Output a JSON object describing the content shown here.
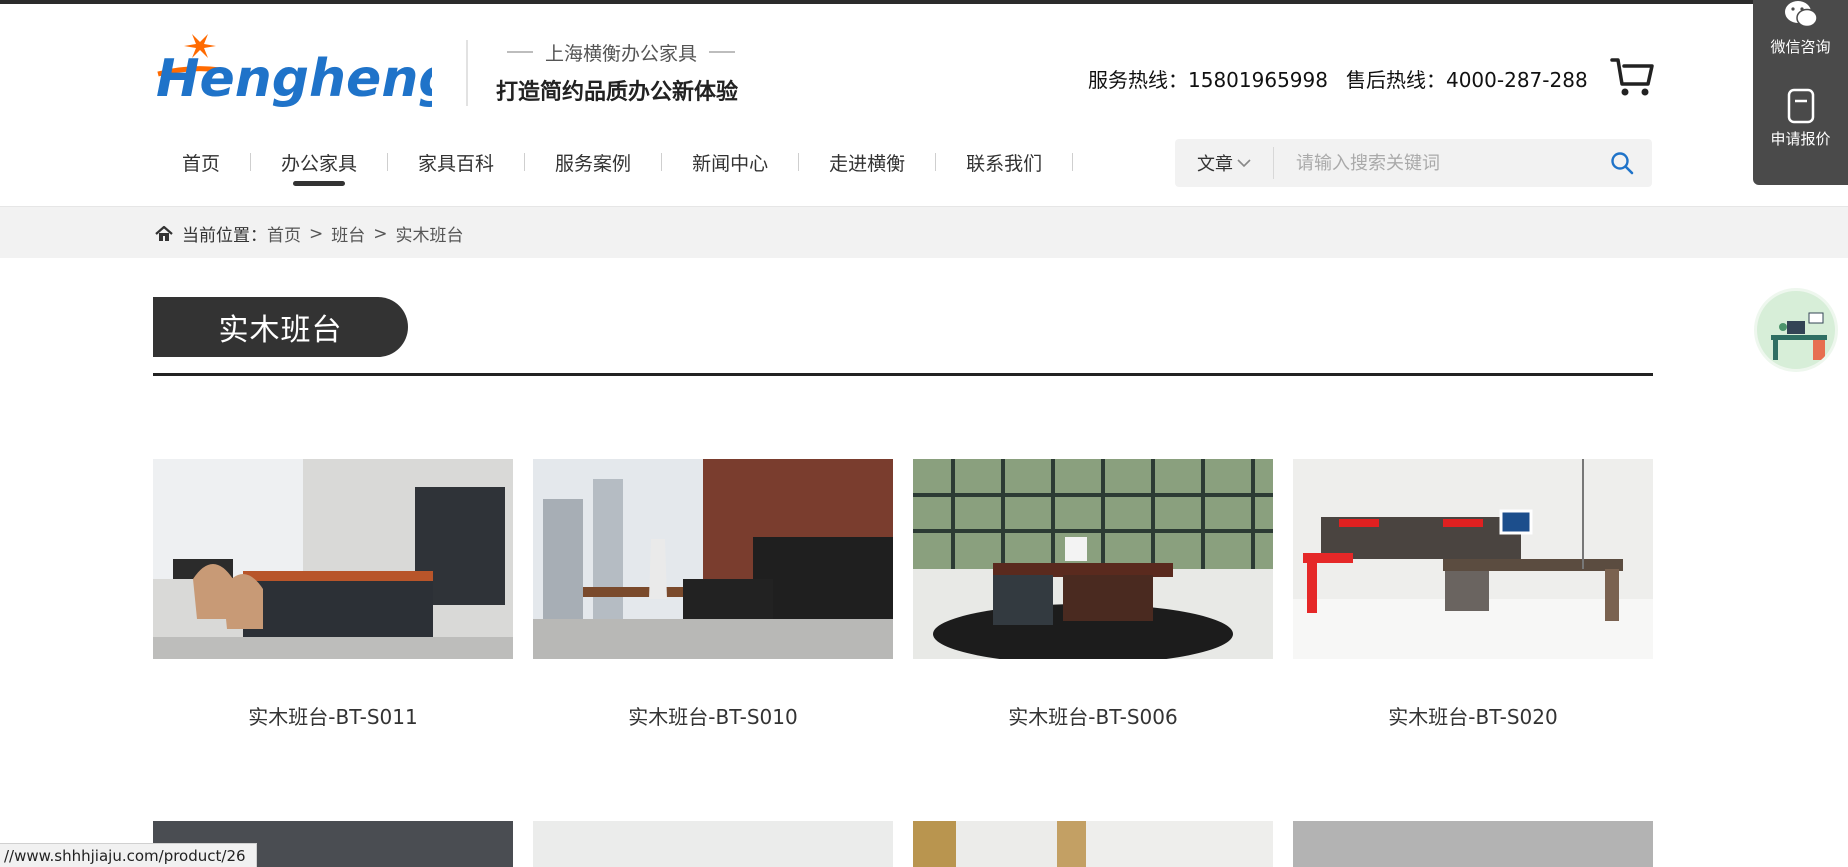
{
  "brand": {
    "logo_text": "Hengheng",
    "slogan_top": "上海横衡办公家具",
    "slogan_main": "打造简约品质办公新体验"
  },
  "hotline": {
    "service": "服务热线：15801965998",
    "aftersale": "售后热线：4000-287-288"
  },
  "nav": {
    "items": [
      {
        "label": "首页"
      },
      {
        "label": "办公家具"
      },
      {
        "label": "家具百科"
      },
      {
        "label": "服务案例"
      },
      {
        "label": "新闻中心"
      },
      {
        "label": "走进横衡"
      },
      {
        "label": "联系我们"
      }
    ],
    "active_index": 1
  },
  "search": {
    "type_label": "文章",
    "placeholder": "请输入搜索关键词"
  },
  "breadcrumb": {
    "prefix": "当前位置：",
    "items": [
      "首页",
      "班台",
      "实木班台"
    ],
    "separator": ">"
  },
  "category": {
    "title": "实木班台"
  },
  "products": [
    {
      "name": "实木班台-BT-S011"
    },
    {
      "name": "实木班台-BT-S010"
    },
    {
      "name": "实木班台-BT-S006"
    },
    {
      "name": "实木班台-BT-S020"
    }
  ],
  "float_panel": {
    "wechat_label": "微信咨询",
    "quote_label": "申请报价"
  },
  "status_bar": {
    "url": "//www.shhhjiaju.com/product/26"
  },
  "colors": {
    "accent_blue": "#1f73c9",
    "accent_orange": "#ff6a00",
    "dark": "#333333"
  }
}
